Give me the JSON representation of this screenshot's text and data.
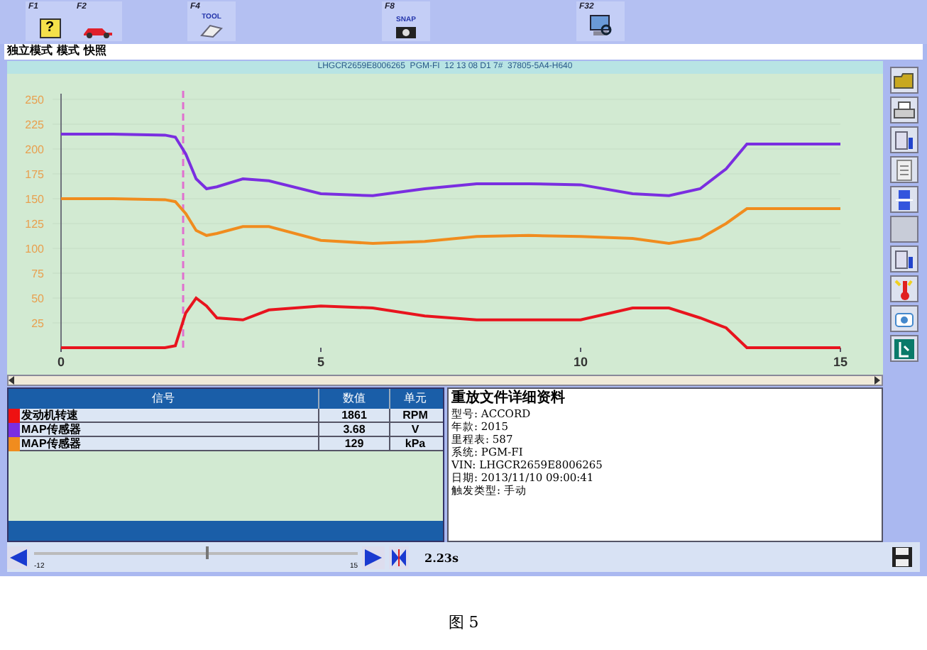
{
  "toolbar": [
    {
      "key": "F1",
      "glyph": "?"
    },
    {
      "key": "F2"
    },
    {
      "key": "F4",
      "caption": "TOOL"
    },
    {
      "key": "F8",
      "caption": "SNAP"
    },
    {
      "key": "F32"
    }
  ],
  "menu": [
    "独立模式",
    "模式",
    "快照"
  ],
  "chart_title": "LHGCR2659E8006265  PGM-FI  12 13 08 D1 7#  37805-5A4-H640",
  "chart": {
    "chart_data": {
      "type": "line",
      "grid": true,
      "ref_lines": [
        {
          "axis": "x",
          "value": 2.35
        }
      ],
      "x": [
        0,
        1,
        2,
        2.2,
        2.4,
        2.6,
        2.8,
        3,
        3.5,
        4,
        5,
        6,
        7,
        8,
        9,
        10,
        11,
        11.7,
        12.3,
        12.8,
        13.2,
        14,
        15
      ],
      "xlim": [
        0,
        15
      ],
      "ylim": [
        0,
        250
      ],
      "xticks": [
        0,
        5,
        10,
        15
      ],
      "yticks": [
        25,
        50,
        75,
        100,
        125,
        150,
        175,
        200,
        225,
        250
      ],
      "series": [
        {
          "color": "#7a2ee0",
          "values": [
            215,
            215,
            214,
            212,
            195,
            170,
            160,
            162,
            170,
            168,
            155,
            153,
            160,
            165,
            165,
            164,
            155,
            153,
            160,
            180,
            205,
            205,
            205
          ]
        },
        {
          "color": "#f08c1e",
          "values": [
            150,
            150,
            149,
            147,
            135,
            118,
            113,
            115,
            122,
            122,
            108,
            105,
            107,
            112,
            113,
            112,
            110,
            105,
            110,
            125,
            140,
            140,
            140
          ]
        },
        {
          "color": "#e8141e",
          "values": [
            0,
            0,
            0,
            2,
            35,
            50,
            42,
            30,
            28,
            38,
            42,
            40,
            32,
            28,
            28,
            28,
            40,
            40,
            30,
            20,
            0,
            0,
            0
          ]
        }
      ]
    }
  },
  "side_tools": [
    {
      "disabled": false
    },
    {
      "disabled": false
    },
    {
      "disabled": false
    },
    {
      "disabled": false
    },
    {
      "disabled": false
    },
    {
      "disabled": true
    },
    {
      "disabled": false
    },
    {
      "disabled": false
    },
    {
      "disabled": false
    },
    {
      "disabled": false
    }
  ],
  "table": {
    "columns": [
      "信号",
      "数值",
      "单元"
    ],
    "rows": [
      {
        "color": "#ee1111",
        "signal": "发动机转速",
        "value": "1861",
        "unit": "RPM"
      },
      {
        "color": "#7a2ee0",
        "signal": "MAP传感器",
        "value": "3.68",
        "unit": "V"
      },
      {
        "color": "#f08c1e",
        "signal": "MAP传感器",
        "value": "129",
        "unit": "kPa"
      }
    ]
  },
  "details": {
    "title": "重放文件详细资料",
    "lines": [
      "型号: ACCORD",
      "年款: 2015",
      "里程表: 587",
      "系统: PGM-FI",
      "VIN: LHGCR2659E8006265",
      "日期: 2013/11/10 09:00:41",
      "触发类型: 手动"
    ]
  },
  "playback": {
    "min": "-12",
    "max": "15",
    "level": 0.53,
    "reading": "2.23s"
  },
  "caption": "图 5"
}
